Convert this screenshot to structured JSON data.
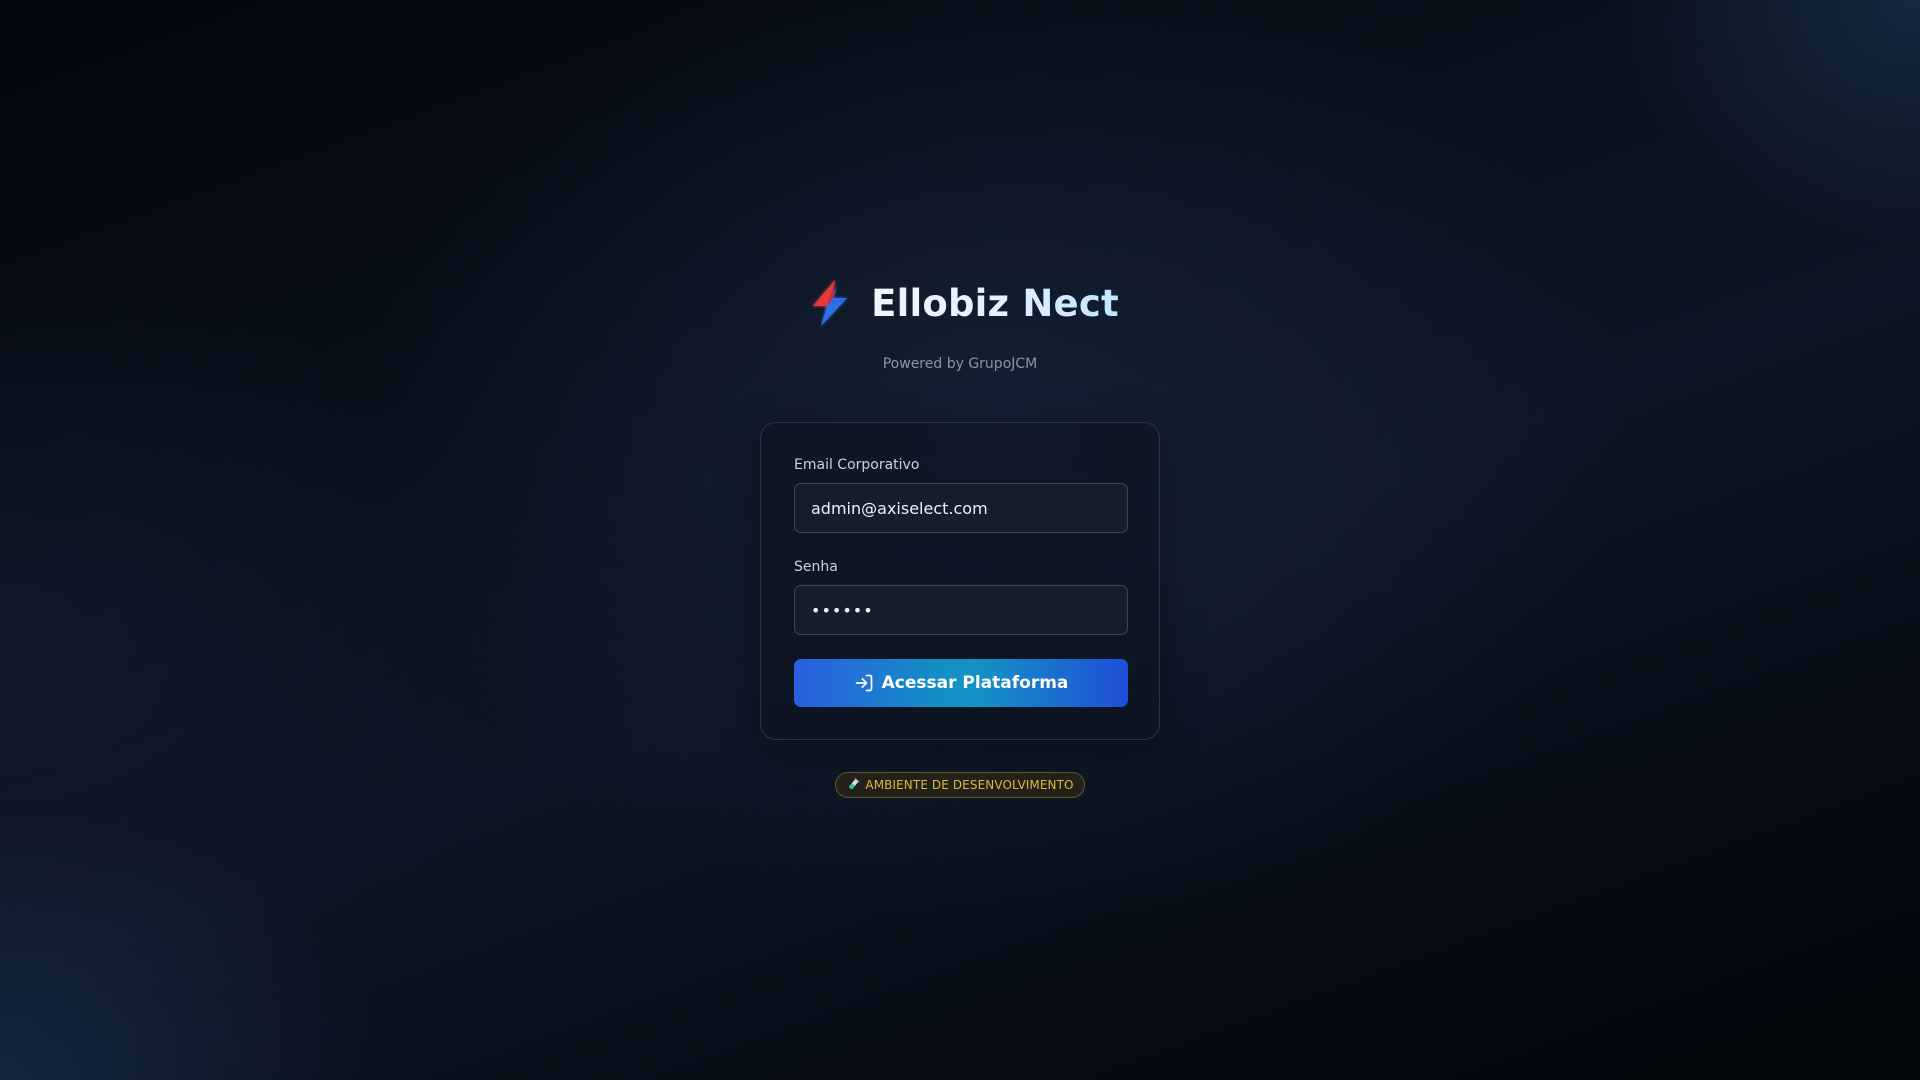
{
  "app": {
    "title": "Ellobiz Nect",
    "subtitle": "Powered by GrupoJCM",
    "logo_icon": "lightning-bolt-icon"
  },
  "login_form": {
    "email_label": "Email Corporativo",
    "email_value": "admin@axiselect.com",
    "password_label": "Senha",
    "password_value": "••••••",
    "submit_label": "Acessar Plataforma",
    "submit_icon": "log-in-icon"
  },
  "environment_badge": {
    "icon": "test-tube-icon",
    "label": "AMBIENTE DE DESENVOLVIMENTO"
  },
  "colors": {
    "accent_blue": "#2a5fe0",
    "accent_cyan": "#1390c4",
    "badge_text": "#e5b53a",
    "bolt_red": "#e23b3b"
  }
}
